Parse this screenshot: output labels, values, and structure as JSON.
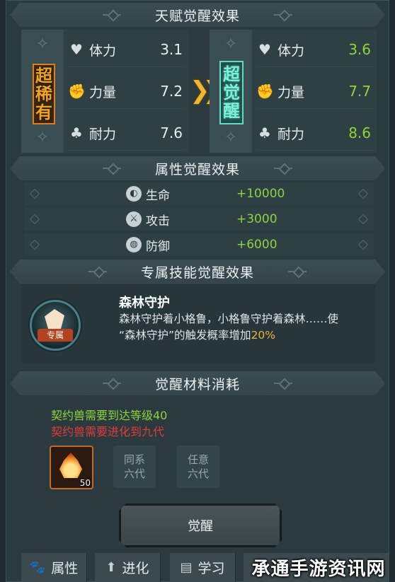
{
  "colors": {
    "accent_green": "#8ed33a",
    "warning_red": "#e03a3a",
    "highlight_orange": "#f0b23a",
    "arrow_gold": "#f3b62a"
  },
  "talent": {
    "title": "天赋觉醒效果",
    "before": {
      "rank": "超稀有",
      "stats": [
        {
          "icon": "heart-icon",
          "label": "体力",
          "value": "3.1"
        },
        {
          "icon": "fist-icon",
          "label": "力量",
          "value": "7.2"
        },
        {
          "icon": "clover-icon",
          "label": "耐力",
          "value": "7.6"
        }
      ]
    },
    "after": {
      "rank": "超觉醒",
      "stats": [
        {
          "icon": "heart-icon",
          "label": "体力",
          "value": "3.6"
        },
        {
          "icon": "fist-icon",
          "label": "力量",
          "value": "7.7"
        },
        {
          "icon": "clover-icon",
          "label": "耐力",
          "value": "8.6"
        }
      ]
    }
  },
  "attributes": {
    "title": "属性觉醒效果",
    "rows": [
      {
        "icon": "life-icon",
        "label": "生命",
        "value": "+10000"
      },
      {
        "icon": "attack-icon",
        "label": "攻击",
        "value": "+3000"
      },
      {
        "icon": "defense-icon",
        "label": "防御",
        "value": "+6000"
      }
    ]
  },
  "skill": {
    "title": "专属技能觉醒效果",
    "icon_tag": "专属",
    "name": "森林守护",
    "desc_line1": "森林守护着小格鲁，小格鲁守护着森林……使",
    "desc_line2_prefix": "“森林守护”的触发概率增加",
    "desc_highlight": "20%"
  },
  "materials": {
    "title": "觉醒材料消耗",
    "requirement_met": "契约兽需要到达等级40",
    "requirement_unmet": "契约兽需要进化到九代",
    "item_count": "50",
    "slot2": {
      "line1": "同系",
      "line2": "六代"
    },
    "slot3": {
      "line1": "任意",
      "line2": "六代"
    }
  },
  "awaken_button": "觉醒",
  "tabs": [
    {
      "icon": "paw-icon",
      "label": "属性"
    },
    {
      "icon": "evolve-icon",
      "label": "进化"
    },
    {
      "icon": "book-icon",
      "label": "学习"
    }
  ],
  "watermark": "承通手游资讯网"
}
